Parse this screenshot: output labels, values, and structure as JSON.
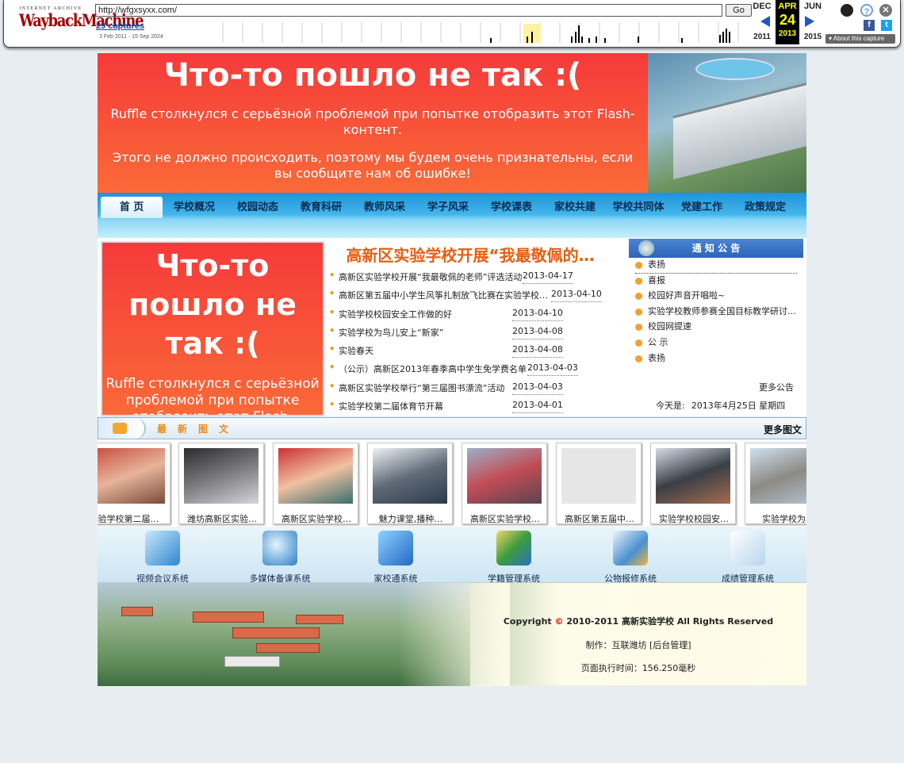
{
  "wayback": {
    "logo_top": "INTERNET ARCHIVE",
    "logo_main": "WaybackMachine",
    "url": "http://wfgxsyxx.com/",
    "go_label": "Go",
    "captures": "29 captures",
    "range": "3 Feb 2011 - 15 Sep 2024",
    "prev_month": "DEC",
    "cur_month": "APR",
    "next_month": "JUN",
    "day": "24",
    "prev_year": "2011",
    "cur_year": "2013",
    "next_year": "2015",
    "about": "About this capture",
    "help_icon": "?",
    "close_icon": "✕",
    "fb": "f",
    "tw": "t"
  },
  "flash_error": {
    "title": "Что-то пошло не так :(",
    "line1": "Ruffle столкнулся с серьёзной проблемой при попытке отобразить этот Flash-контент.",
    "line2": "Этого не должно происходить, поэтому мы будем очень признательны, если вы сообщите нам об ошибке!",
    "small_line1": "Ruffle столкнулся с серьёзной проблемой при попытке отобразить этот Flash-контент."
  },
  "nav": [
    "首 页",
    "学校概况",
    "校园动态",
    "教育科研",
    "教师风采",
    "学子风采",
    "学校课表",
    "家校共建",
    "学校共同体",
    "党建工作",
    "政策规定"
  ],
  "news": {
    "headline": "高新区实验学校开展“我最敬佩的…",
    "items": [
      {
        "title": "高新区实验学校开展“我最敬佩的老师”评选活动",
        "date": "2013-04-17"
      },
      {
        "title": "高新区第五届中小学生风筝扎制放飞比赛在实验学校…",
        "date": "2013-04-10"
      },
      {
        "title": "实验学校校园安全工作做的好",
        "date": "2013-04-10"
      },
      {
        "title": "实验学校为鸟儿安上“新家”",
        "date": "2013-04-08"
      },
      {
        "title": "实验春天",
        "date": "2013-04-08"
      },
      {
        "title": "（公示）高新区2013年春季高中学生免学费名单",
        "date": "2013-04-03"
      },
      {
        "title": "高新区实验学校举行“第三届图书漂流”活动",
        "date": "2013-04-03"
      },
      {
        "title": "实验学校第二届体育节开幕",
        "date": "2013-04-01"
      }
    ]
  },
  "notice": {
    "title": "通 知 公 告",
    "items": [
      "表扬",
      "喜报",
      "校园好声音开唱啦~",
      "实验学校教师参赛全国目标教学研讨…",
      "校园网提速",
      "公 示",
      "表扬"
    ],
    "more": "更多公告",
    "today_label": "今天是:",
    "today_value": "2013年4月25日 星期四"
  },
  "latest": {
    "title": "最新图文",
    "more": "更多图文"
  },
  "gallery": [
    "验学校第二届…",
    "潍坊高新区实验…",
    "高新区实验学校…",
    "魅力课堂,播种…",
    "高新区实验学校…",
    "高新区第五届中…",
    "实验学校校园安…",
    "实验学校为鸟"
  ],
  "systems": [
    "视频会议系统",
    "多媒体备课系统",
    "家校通系统",
    "学籍管理系统",
    "公物报修系统",
    "成绩管理系统"
  ],
  "footer": {
    "copy_pre": "Copyright",
    "copy_sym": "©",
    "copy_post": "2010-2011 高新实验学校    All Rights Reserved",
    "made": "制作：互联潍坊    [后台管理]",
    "exec": "页面执行时间：156.250毫秒"
  },
  "colors": {
    "error_red": "#f53a3a",
    "nav_blue": "#1f93d9",
    "headline_orange": "#e85d12"
  }
}
